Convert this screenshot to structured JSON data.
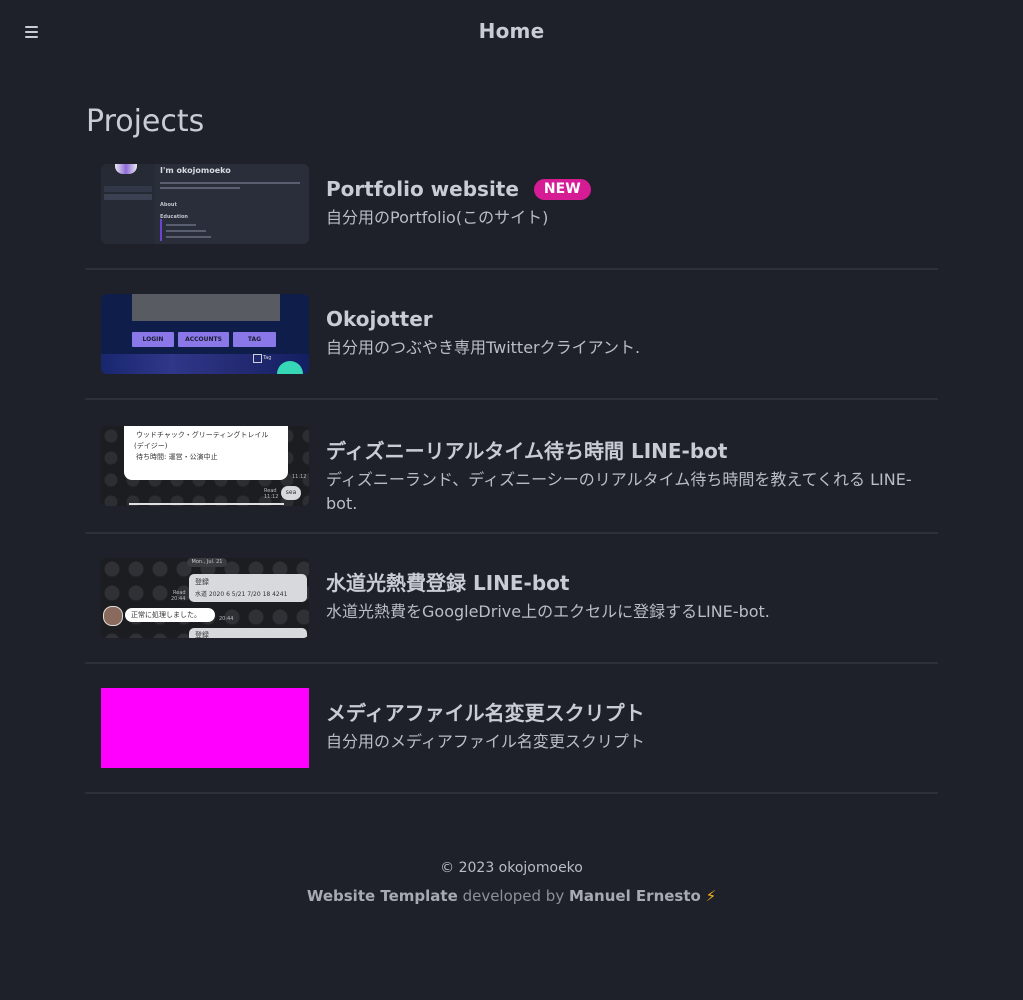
{
  "header": {
    "title": "Home",
    "menu_icon": "hamburger-menu-icon"
  },
  "main": {
    "section_title": "Projects",
    "projects": [
      {
        "title": "Portfolio website",
        "badge": "NEW",
        "description": "自分用のPortfolio(このサイト)",
        "thumbnail": {
          "heading": "I'm okojomoeko",
          "about": "About",
          "education": "Education"
        }
      },
      {
        "title": "Okojotter",
        "description": "自分用のつぶやき専用Twitterクライアント.",
        "thumbnail": {
          "buttons": [
            "LOGIN",
            "ACCOUNTS",
            "TAG"
          ],
          "tag_label": "Tag"
        }
      },
      {
        "title": "ディズニーリアルタイム待ち時間 LINE-bot",
        "description": "ディズニーランド、ディズニーシーのリアルタイム待ち時間を教えてくれる LINE-bot.",
        "thumbnail": {
          "line1": "ウッドチャック・グリーティングトレイル",
          "line2": "(デイジー)",
          "line3": "待ち時間: 運営・公演中止",
          "time1": "11:12",
          "time2": "11:12",
          "read_label": "Read",
          "chip": "sea"
        }
      },
      {
        "title": "水道光熱費登録 LINE-bot",
        "description": "水道光熱費をGoogleDrive上のエクセルに登録するLINE-bot.",
        "thumbnail": {
          "date": "Mon., Jul. 21",
          "msg1_line1": "登録",
          "msg1_line2": "水道 2020 6 5/21 7/20 18 4241",
          "read_label": "Read",
          "time1": "20:44",
          "reply": "正常に処理しました。",
          "time2": "20:44",
          "msg3": "登録"
        }
      },
      {
        "title": "メディアファイル名変更スクリプト",
        "description": "自分用のメディアファイル名変更スクリプト",
        "thumbnail": {
          "color": "#ff00ff"
        }
      }
    ]
  },
  "footer": {
    "copyright": "© 2023 okojomoeko",
    "template_label": "Website Template",
    "developed_by": "developed by",
    "author": "Manuel Ernesto",
    "bolt": "⚡"
  },
  "colors": {
    "background": "#1e212a",
    "text": "#c9ccd3",
    "badge": "#d61c95",
    "divider": "#2c3039"
  }
}
